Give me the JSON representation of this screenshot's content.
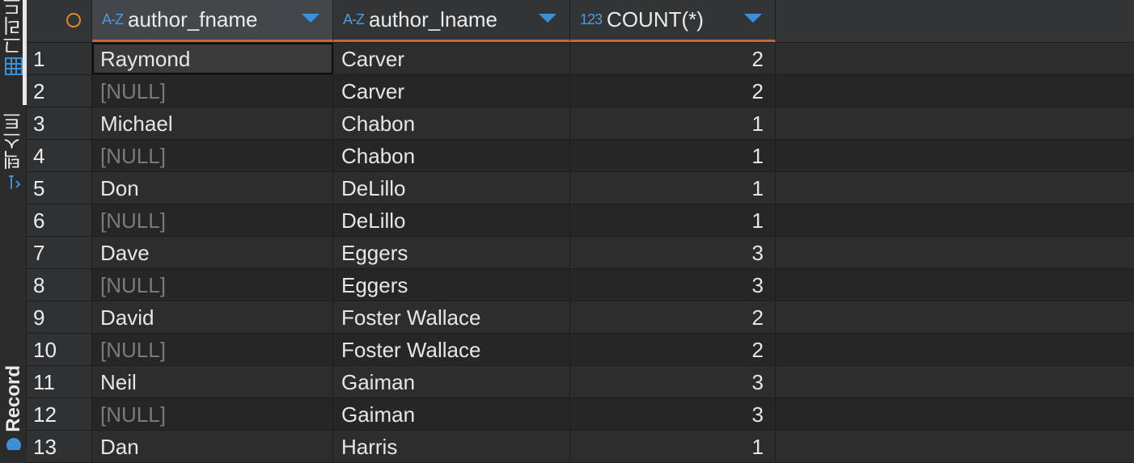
{
  "sidebar": {
    "tabs": [
      {
        "label": "그리드",
        "icon": "grid-icon"
      },
      {
        "label": "텍스트",
        "icon": "text-icon"
      },
      {
        "label": "Record",
        "icon": "record-icon"
      }
    ]
  },
  "columns": [
    {
      "type": "A-Z",
      "name": "author_fname"
    },
    {
      "type": "A-Z",
      "name": "author_lname"
    },
    {
      "type": "123",
      "name": "COUNT(*)"
    }
  ],
  "rows": [
    {
      "n": "1",
      "fname": "Raymond",
      "lname": "Carver",
      "count": "2"
    },
    {
      "n": "2",
      "fname": "[NULL]",
      "lname": "Carver",
      "count": "2"
    },
    {
      "n": "3",
      "fname": "Michael",
      "lname": "Chabon",
      "count": "1"
    },
    {
      "n": "4",
      "fname": "[NULL]",
      "lname": "Chabon",
      "count": "1"
    },
    {
      "n": "5",
      "fname": "Don",
      "lname": "DeLillo",
      "count": "1"
    },
    {
      "n": "6",
      "fname": "[NULL]",
      "lname": "DeLillo",
      "count": "1"
    },
    {
      "n": "7",
      "fname": "Dave",
      "lname": "Eggers",
      "count": "3"
    },
    {
      "n": "8",
      "fname": "[NULL]",
      "lname": "Eggers",
      "count": "3"
    },
    {
      "n": "9",
      "fname": "David",
      "lname": "Foster Wallace",
      "count": "2"
    },
    {
      "n": "10",
      "fname": "[NULL]",
      "lname": "Foster Wallace",
      "count": "2"
    },
    {
      "n": "11",
      "fname": "Neil",
      "lname": "Gaiman",
      "count": "3"
    },
    {
      "n": "12",
      "fname": "[NULL]",
      "lname": "Gaiman",
      "count": "3"
    },
    {
      "n": "13",
      "fname": "Dan",
      "lname": "Harris",
      "count": "1"
    }
  ],
  "colors": {
    "accent": "#3d8fd8",
    "header_underline": "#c8663a",
    "null_text": "#7a7a7a"
  }
}
